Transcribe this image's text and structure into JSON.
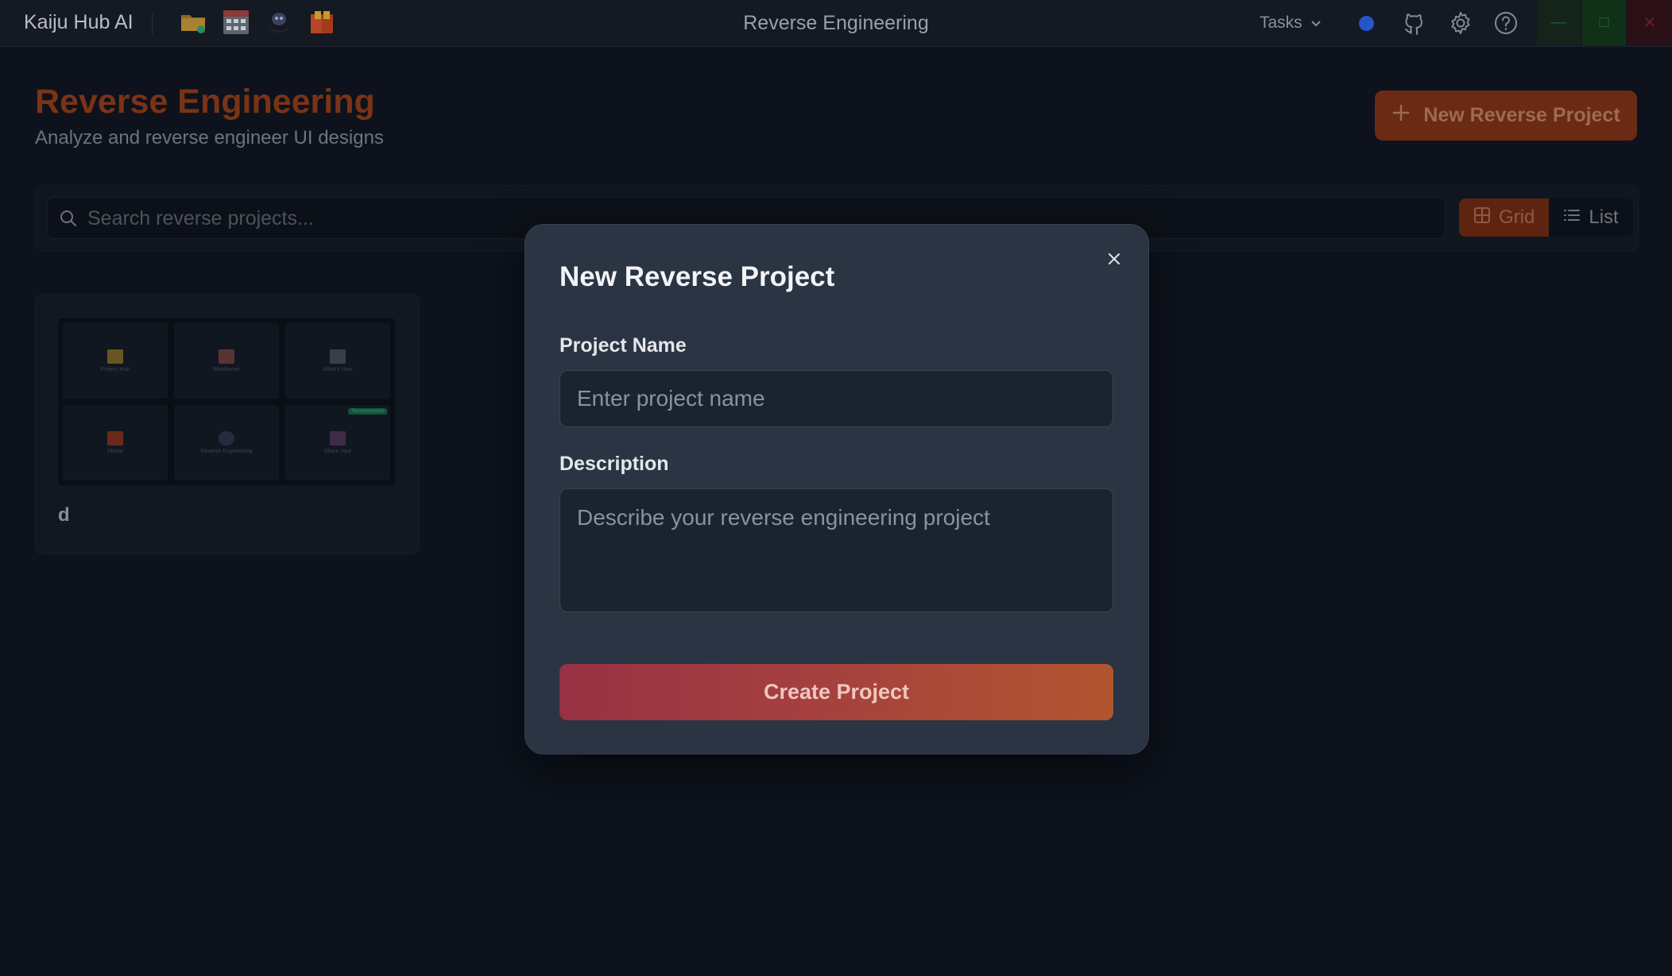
{
  "titlebar": {
    "app_name": "Kaiju Hub AI",
    "window_title": "Reverse Engineering",
    "tasks_label": "Tasks",
    "icons": [
      "folder-icon",
      "calendar-grid-icon",
      "robot-icon",
      "book-icon"
    ],
    "status_color": "#2556c9"
  },
  "header": {
    "title": "Reverse Engineering",
    "subtitle": "Analyze and reverse engineer UI designs",
    "new_button_label": "New Reverse Project"
  },
  "toolbar": {
    "search_placeholder": "Search reverse projects...",
    "view_grid_label": "Grid",
    "view_list_label": "List",
    "active_view": "Grid"
  },
  "projects": [
    {
      "title": "d",
      "thumbnail_tiles": [
        {
          "label": "Project Hub"
        },
        {
          "label": "Wireframer"
        },
        {
          "label": "What's New"
        },
        {
          "label": "Media"
        },
        {
          "label": "Reverse Engineering"
        },
        {
          "label": "Share Your",
          "badge": "Recommended"
        }
      ]
    }
  ],
  "modal": {
    "title": "New Reverse Project",
    "name_label": "Project Name",
    "name_placeholder": "Enter project name",
    "name_value": "",
    "description_label": "Description",
    "description_placeholder": "Describe your reverse engineering project",
    "description_value": "",
    "create_label": "Create Project"
  },
  "colors": {
    "accent": "#b1552f",
    "accent_gradient_start": "#963243",
    "background": "#0d121c",
    "modal_bg": "#2b3442"
  }
}
